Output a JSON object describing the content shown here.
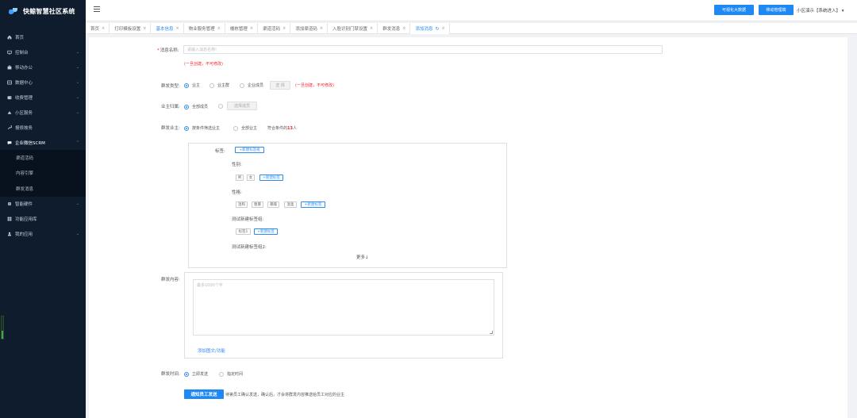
{
  "app": {
    "logo_text": "快鲸智慧社区系统"
  },
  "sidebar": {
    "items": [
      {
        "label": "首页",
        "icon": "home-icon",
        "has_chevron": false
      },
      {
        "label": "控制台",
        "icon": "monitor-icon",
        "has_chevron": true
      },
      {
        "label": "移动办公",
        "icon": "briefcase-icon",
        "has_chevron": true
      },
      {
        "label": "数据中心",
        "icon": "database-icon",
        "has_chevron": true
      },
      {
        "label": "收费管理",
        "icon": "wallet-icon",
        "has_chevron": true
      },
      {
        "label": "小区服务",
        "icon": "service-icon",
        "has_chevron": true
      },
      {
        "label": "报修故务",
        "icon": "wrench-icon",
        "has_chevron": false
      },
      {
        "label": "企业微信SCRM",
        "icon": "chat-icon",
        "has_chevron": true,
        "open": true
      }
    ],
    "sub_items": [
      {
        "label": "渠道活码"
      },
      {
        "label": "内容引擎"
      },
      {
        "label": "群发消息"
      }
    ],
    "items_after": [
      {
        "label": "智能硬件",
        "icon": "chip-icon",
        "has_chevron": true
      },
      {
        "label": "功能应用库",
        "icon": "apps-icon",
        "has_chevron": false
      },
      {
        "label": "我的应用",
        "icon": "user-icon",
        "has_chevron": true
      }
    ]
  },
  "header": {
    "btn_bigdata": "可视化大数据",
    "btn_mobile": "移动管理端",
    "user_text": "小区演示【系统进入】",
    "user_caret": "▾"
  },
  "tabs": [
    {
      "label": "首页"
    },
    {
      "label": "打印模板设置"
    },
    {
      "label": "基本信息",
      "blue": true
    },
    {
      "label": "物业服务管理"
    },
    {
      "label": "楼栋管理"
    },
    {
      "label": "渠道活码"
    },
    {
      "label": "添加渠道码"
    },
    {
      "label": "入脸识别门禁设置"
    },
    {
      "label": "群发消息"
    },
    {
      "label": "添加消息",
      "active": true
    }
  ],
  "form": {
    "name_label": "消息名称:",
    "name_placeholder": "请输入消息名称!",
    "name_warn": "(一旦创建，不可修改)",
    "type_label": "群发类型:",
    "type_options": [
      "业主",
      "业主群",
      "企业成员"
    ],
    "type_select_btn": "选 择",
    "type_warn": "(一旦创建，不可修改)",
    "scope_label": "业主归属:",
    "scope_options": [
      "全部成员",
      "选择成员"
    ],
    "scope_select_btn": "选择成员",
    "target_label": "群发业主:",
    "target_options": [
      "按条件筛选业主",
      "全部业主"
    ],
    "target_match_prefix": "符合条件的",
    "target_match_count": "13",
    "target_match_suffix": "人",
    "tag_section_label": "标签:",
    "new_tag_group": "+新建标签组",
    "groups": [
      {
        "title": "性别:",
        "tags": [
          "男",
          "女"
        ]
      },
      {
        "title": "性格:",
        "tags": [
          "温和",
          "粗暴",
          "暴躁",
          "温柔"
        ]
      },
      {
        "title": "测试新建标签组:",
        "tags": [
          "标签1"
        ]
      },
      {
        "title": "测试新建标签组2:",
        "tags": []
      }
    ],
    "new_tag": "+新建标签",
    "more": "更多↓",
    "content_label": "群发内容:",
    "content_placeholder": "最多1000个字",
    "add_media": "添加图文/功能",
    "time_label": "群发时间:",
    "time_options": [
      "立即发送",
      "指定时间"
    ],
    "submit_btn": "通知员工发送",
    "submit_hint": "待第员工确认发送，确认后，才会将群发内容推送给员工对应的业主"
  }
}
